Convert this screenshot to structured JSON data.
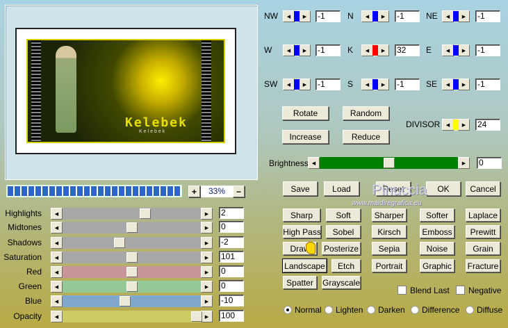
{
  "preview": {
    "artwork_text": "Kelebek",
    "artwork_subtext": "Kelebek",
    "zoom": "33%",
    "zoom_in": "+",
    "zoom_out": "−",
    "progress_fraction": 1.0
  },
  "adjust": [
    {
      "label": "Highlights",
      "value": "2",
      "pos": 0.6,
      "color": "#a8a8a8"
    },
    {
      "label": "Midtones",
      "value": "0",
      "pos": 0.5,
      "color": "#a8a8a8"
    },
    {
      "label": "Shadows",
      "value": "-2",
      "pos": 0.41,
      "color": "#a8a8a8"
    },
    {
      "label": "Saturation",
      "value": "101",
      "pos": 0.5,
      "color": "#a8a8a8"
    },
    {
      "label": "Red",
      "value": "0",
      "pos": 0.5,
      "color": "#c8969a"
    },
    {
      "label": "Green",
      "value": "0",
      "pos": 0.5,
      "color": "#94c896"
    },
    {
      "label": "Blue",
      "value": "-10",
      "pos": 0.45,
      "color": "#80a8cc"
    },
    {
      "label": "Opacity",
      "value": "100",
      "pos": 0.97,
      "color": "#cccc66"
    }
  ],
  "kernel": [
    {
      "label": "NW",
      "value": "-1",
      "color": "#0000ff"
    },
    {
      "label": "N",
      "value": "-1",
      "color": "#0000ff"
    },
    {
      "label": "NE",
      "value": "-1",
      "color": "#0000ff"
    },
    {
      "label": "W",
      "value": "-1",
      "color": "#0000ff"
    },
    {
      "label": "K",
      "value": "32",
      "color": "#ff0000"
    },
    {
      "label": "E",
      "value": "-1",
      "color": "#0000ff"
    },
    {
      "label": "SW",
      "value": "-1",
      "color": "#0000ff"
    },
    {
      "label": "S",
      "value": "-1",
      "color": "#0000ff"
    },
    {
      "label": "SE",
      "value": "-1",
      "color": "#0000ff"
    }
  ],
  "kernel_buttons": [
    "Rotate",
    "Random",
    "Increase",
    "Reduce"
  ],
  "divisor": {
    "label": "DIVISOR",
    "value": "24",
    "color": "#ffff00"
  },
  "brightness": {
    "label": "Brightness",
    "value": "0",
    "pos": 0.5,
    "color": "#008000"
  },
  "actions": [
    "Save",
    "Load",
    "Reset",
    "OK",
    "Cancel"
  ],
  "watermark": {
    "name": "Pinuccia",
    "url": "www.maidiregrafica.eu"
  },
  "filters": [
    [
      "Sharp",
      "Soft",
      "Sharper",
      "Softer",
      "Laplace"
    ],
    [
      "High Pass",
      "Sobel",
      "Kirsch",
      "Emboss",
      "Prewitt"
    ],
    [
      "Draw",
      "Posterize",
      "Sepia",
      "Noise",
      "Grain"
    ],
    [
      "Landscape",
      "Etch",
      "Portrait",
      "Graphic",
      "Fracture"
    ],
    [
      "Spatter",
      "Grayscale"
    ]
  ],
  "focused_filter": "Landscape",
  "checkboxes": [
    {
      "label": "Blend Last",
      "checked": false
    },
    {
      "label": "Negative",
      "checked": false
    }
  ],
  "blend_modes": [
    {
      "label": "Normal",
      "selected": true
    },
    {
      "label": "Lighten",
      "selected": false
    },
    {
      "label": "Darken",
      "selected": false
    },
    {
      "label": "Difference",
      "selected": false
    },
    {
      "label": "Diffuse",
      "selected": false
    }
  ]
}
